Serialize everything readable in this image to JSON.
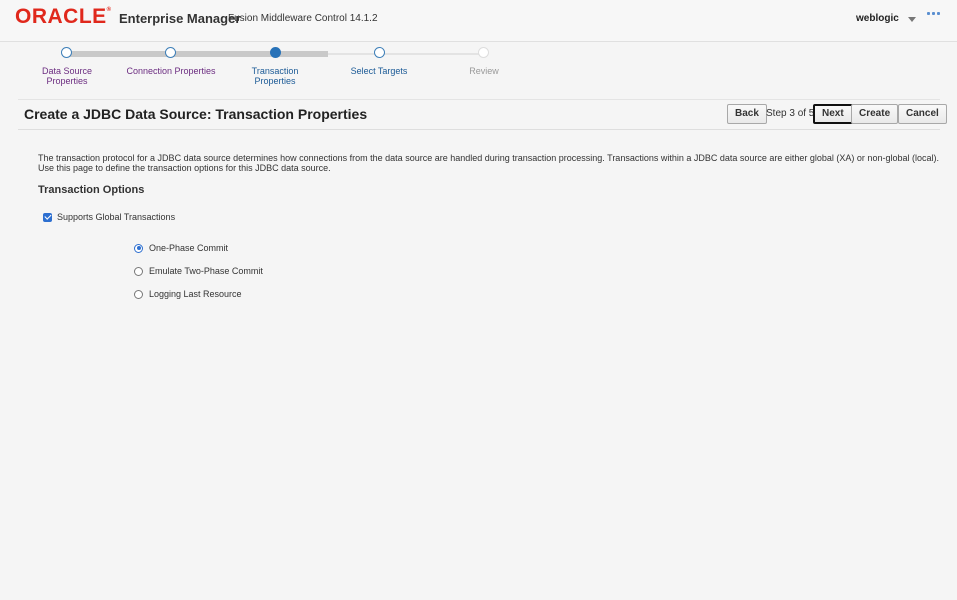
{
  "header": {
    "logo": "ORACLE",
    "logo_reg": "®",
    "product": "Enterprise Manager",
    "subproduct": "Fusion Middleware Control 14.1.2",
    "user": "weblogic",
    "more_icon": "ellipsis-icon"
  },
  "train": {
    "steps": [
      {
        "label_line1": "Data Source",
        "label_line2": "Properties",
        "state": "visited"
      },
      {
        "label_line1": "Connection Properties",
        "label_line2": "",
        "state": "visited"
      },
      {
        "label_line1": "Transaction",
        "label_line2": "Properties",
        "state": "current"
      },
      {
        "label_line1": "Select Targets",
        "label_line2": "",
        "state": "next"
      },
      {
        "label_line1": "Review",
        "label_line2": "",
        "state": "disabled"
      }
    ]
  },
  "titlebar": {
    "title": "Create a JDBC Data Source: Transaction Properties",
    "back_label": "Back",
    "step_text": "Step 3 of 5",
    "next_label": "Next",
    "create_label": "Create",
    "cancel_label": "Cancel"
  },
  "main": {
    "description_line1": "The transaction protocol for a JDBC data source determines how connections from the data source are handled during transaction processing. Transactions within a JDBC data source are either global (XA) or non-global (local).",
    "description_line2": "Use this page to define the transaction options for this JDBC data source.",
    "section_title": "Transaction Options",
    "global_tx_label": "Supports Global Transactions",
    "global_tx_checked": true,
    "options": [
      {
        "label": "One-Phase Commit",
        "selected": true
      },
      {
        "label": "Emulate Two-Phase Commit",
        "selected": false
      },
      {
        "label": "Logging Last Resource",
        "selected": false
      }
    ]
  },
  "colors": {
    "brand_red": "#e0281c",
    "accent_blue": "#2872b8",
    "visited_purple": "#6b2c80"
  }
}
